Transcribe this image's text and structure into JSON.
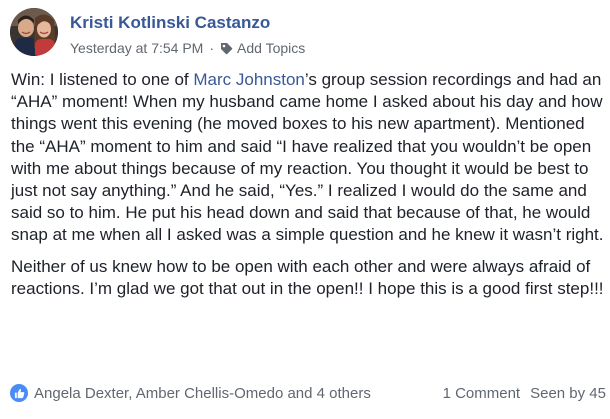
{
  "post": {
    "author": "Kristi Kotlinski Castanzo",
    "timestamp": "Yesterday at 7:54 PM",
    "separator": "·",
    "add_topics": "Add Topics",
    "paragraphs": [
      {
        "before": "Win: I listened to one of ",
        "mention": "Marc Johnston",
        "after": "’s group session recordings and had an “AHA” moment! When my husband came home I asked about his day and how things went this evening (he moved boxes to his new apartment). Mentioned the “AHA” moment to him and said “I have realized that you wouldn’t be open with me about things because of my reaction. You thought it would be best to just not say anything.” And he said, “Yes.” I realized I would do the same and said so to him. He put his head down and said that because of that, he would snap at me when all I asked was a simple question and he knew it wasn’t right."
      },
      {
        "text": "Neither of us knew how to be open with each other and were always afraid of reactions. I’m glad we got that out in the open!! I hope this is a good first step!!!"
      }
    ],
    "reactions": {
      "names": "Angela Dexter, Amber Chellis-Omedo and 4 others",
      "icon": "like-icon",
      "color": "#4a8cf7"
    },
    "comments": "1 Comment",
    "seen_by": "Seen by 45"
  },
  "colors": {
    "link": "#385898",
    "text": "#1d2129",
    "meta": "#606770"
  }
}
